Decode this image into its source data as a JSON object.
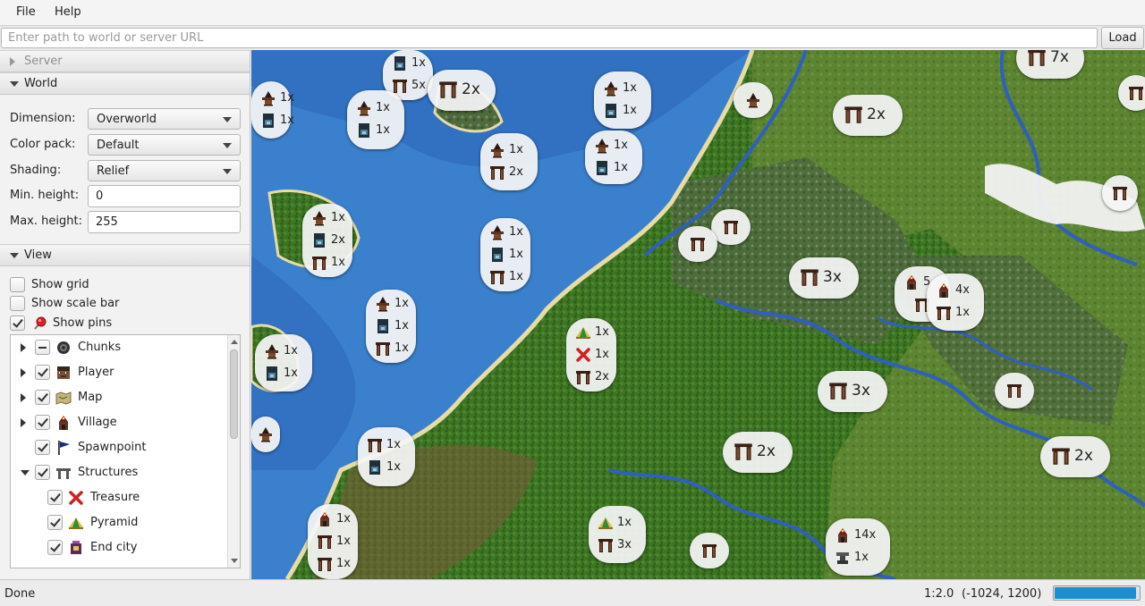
{
  "menu": {
    "file": "File",
    "help": "Help"
  },
  "pathbar": {
    "placeholder": "Enter path to world or server URL",
    "load_label": "Load"
  },
  "panes": {
    "server": {
      "title": "Server",
      "expanded": false
    },
    "world": {
      "title": "World",
      "expanded": true,
      "dimension_label": "Dimension:",
      "dimension_value": "Overworld",
      "colorpack_label": "Color pack:",
      "colorpack_value": "Default",
      "shading_label": "Shading:",
      "shading_value": "Relief",
      "min_height_label": "Min. height:",
      "min_height_value": "0",
      "max_height_label": "Max. height:",
      "max_height_value": "255"
    },
    "view": {
      "title": "View",
      "expanded": true,
      "show_grid": {
        "label": "Show grid",
        "checked": false
      },
      "show_scale_bar": {
        "label": "Show scale bar",
        "checked": false
      },
      "show_pins": {
        "label": "Show pins",
        "checked": true
      }
    }
  },
  "pin_tree": [
    {
      "label": "Chunks",
      "icon": "chunk-icon",
      "state": "indeterminate",
      "expander": "collapsed",
      "depth": 0
    },
    {
      "label": "Player",
      "icon": "player-head-icon",
      "state": "checked",
      "expander": "collapsed",
      "depth": 0
    },
    {
      "label": "Map",
      "icon": "map-icon",
      "state": "checked",
      "expander": "collapsed",
      "depth": 0
    },
    {
      "label": "Village",
      "icon": "village-icon",
      "state": "checked",
      "expander": "collapsed",
      "depth": 0
    },
    {
      "label": "Spawnpoint",
      "icon": "spawn-flag-icon",
      "state": "checked",
      "expander": "none",
      "depth": 0
    },
    {
      "label": "Structures",
      "icon": "structures-icon",
      "state": "checked",
      "expander": "expanded",
      "depth": 0
    },
    {
      "label": "Treasure",
      "icon": "treasure-x-icon",
      "state": "checked",
      "expander": "none",
      "depth": 1
    },
    {
      "label": "Pyramid",
      "icon": "pyramid-icon",
      "state": "checked",
      "expander": "none",
      "depth": 1
    },
    {
      "label": "End city",
      "icon": "end-city-icon",
      "state": "checked",
      "expander": "none",
      "depth": 1
    }
  ],
  "map_pins": [
    {
      "name": "pin-1",
      "lines": [
        {
          "icon": "well",
          "count": "1x"
        },
        {
          "icon": "arch",
          "count": "5x"
        }
      ]
    },
    {
      "name": "pin-2",
      "big": true,
      "lines": [
        {
          "icon": "arch",
          "count": "2x"
        }
      ]
    },
    {
      "name": "pin-3",
      "lines": [
        {
          "icon": "hut",
          "count": "1x"
        },
        {
          "icon": "well",
          "count": "1x"
        }
      ]
    },
    {
      "name": "pin-4",
      "lines": [
        {
          "icon": "hut",
          "count": "1x"
        },
        {
          "icon": "well",
          "count": "1x"
        }
      ]
    },
    {
      "name": "pin-5",
      "lines": [
        {
          "icon": "hut",
          "count": "1x"
        },
        {
          "icon": "well",
          "count": "1x"
        }
      ]
    },
    {
      "name": "pin-6",
      "lines": [
        {
          "icon": "hut",
          "count": ""
        }
      ]
    },
    {
      "name": "pin-7",
      "big": true,
      "lines": [
        {
          "icon": "arch",
          "count": "2x"
        }
      ]
    },
    {
      "name": "pin-8",
      "big": true,
      "lines": [
        {
          "icon": "arch",
          "count": "7x"
        }
      ]
    },
    {
      "name": "pin-9",
      "lines": [
        {
          "icon": "hut",
          "count": "1x"
        },
        {
          "icon": "arch",
          "count": "2x"
        }
      ]
    },
    {
      "name": "pin-10",
      "lines": [
        {
          "icon": "hut",
          "count": "1x"
        },
        {
          "icon": "well",
          "count": "1x"
        }
      ]
    },
    {
      "name": "pin-11",
      "lines": [
        {
          "icon": "hut",
          "count": "1x"
        },
        {
          "icon": "well",
          "count": "2x"
        },
        {
          "icon": "arch",
          "count": "1x"
        }
      ]
    },
    {
      "name": "pin-12",
      "lines": [
        {
          "icon": "hut",
          "count": "1x"
        },
        {
          "icon": "well",
          "count": "1x"
        },
        {
          "icon": "arch",
          "count": "1x"
        }
      ]
    },
    {
      "name": "pin-13",
      "lines": [
        {
          "icon": "arch",
          "count": ""
        }
      ]
    },
    {
      "name": "pin-14",
      "lines": [
        {
          "icon": "arch",
          "count": ""
        }
      ]
    },
    {
      "name": "pin-15",
      "big": true,
      "lines": [
        {
          "icon": "arch",
          "count": "3x"
        }
      ]
    },
    {
      "name": "pin-16",
      "lines": [
        {
          "icon": "village",
          "count": "5"
        },
        {
          "icon": "arch",
          "count": ""
        }
      ]
    },
    {
      "name": "pin-17",
      "lines": [
        {
          "icon": "village",
          "count": "4x"
        },
        {
          "icon": "arch",
          "count": "1x"
        }
      ]
    },
    {
      "name": "pin-18",
      "lines": [
        {
          "icon": "arch",
          "count": ""
        }
      ]
    },
    {
      "name": "pin-19",
      "lines": [
        {
          "icon": "arch",
          "count": ""
        }
      ]
    },
    {
      "name": "pin-20",
      "lines": [
        {
          "icon": "hut",
          "count": "1x"
        },
        {
          "icon": "well",
          "count": "1x"
        },
        {
          "icon": "arch",
          "count": "1x"
        }
      ]
    },
    {
      "name": "pin-21",
      "lines": [
        {
          "icon": "hut",
          "count": "1x"
        },
        {
          "icon": "well",
          "count": "1x"
        }
      ]
    },
    {
      "name": "pin-22",
      "lines": [
        {
          "icon": "pyramid",
          "count": "1x"
        },
        {
          "icon": "treasure",
          "count": "1x"
        },
        {
          "icon": "arch",
          "count": "2x"
        }
      ]
    },
    {
      "name": "pin-23",
      "big": true,
      "lines": [
        {
          "icon": "arch",
          "count": "3x"
        }
      ]
    },
    {
      "name": "pin-24",
      "lines": [
        {
          "icon": "arch",
          "count": ""
        }
      ]
    },
    {
      "name": "pin-25",
      "lines": [
        {
          "icon": "hut",
          "count": ""
        }
      ]
    },
    {
      "name": "pin-26",
      "lines": [
        {
          "icon": "arch",
          "count": "1x"
        },
        {
          "icon": "well",
          "count": "1x"
        }
      ]
    },
    {
      "name": "pin-27",
      "big": true,
      "lines": [
        {
          "icon": "arch",
          "count": "2x"
        }
      ]
    },
    {
      "name": "pin-28",
      "big": true,
      "lines": [
        {
          "icon": "arch",
          "count": "2x"
        }
      ]
    },
    {
      "name": "pin-29",
      "lines": [
        {
          "icon": "village",
          "count": "1x"
        },
        {
          "icon": "arch",
          "count": "1x"
        },
        {
          "icon": "arch",
          "count": "1x"
        }
      ]
    },
    {
      "name": "pin-30",
      "lines": [
        {
          "icon": "pyramid",
          "count": "1x"
        },
        {
          "icon": "arch",
          "count": "3x"
        }
      ]
    },
    {
      "name": "pin-31",
      "lines": [
        {
          "icon": "arch",
          "count": ""
        }
      ]
    },
    {
      "name": "pin-32",
      "lines": [
        {
          "icon": "village",
          "count": "14x"
        },
        {
          "icon": "anvil",
          "count": "1x"
        }
      ]
    }
  ],
  "status": {
    "text": "Done",
    "scale": "1:2.0",
    "coords": "(-1024, 1200)",
    "progress": 0.97
  },
  "colors": {
    "water": "#3a7fc9",
    "deep_water": "#2a5db5",
    "forest": "#3c6e22",
    "plains": "#6d8f3a",
    "accent": "#1c8fcf"
  }
}
